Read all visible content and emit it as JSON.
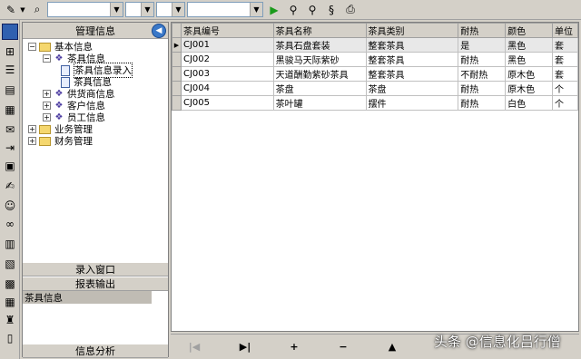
{
  "toolbar": {
    "icons": [
      "pencil-icon",
      "dropdown-arrow-icon",
      "search-icon",
      "play-icon",
      "binoculars-icon",
      "binoculars-next-icon",
      "replace-icon",
      "print-icon"
    ],
    "combos": [
      "",
      "",
      "",
      ""
    ]
  },
  "sidebar": {
    "icons": [
      "window-icon",
      "network-icon",
      "list-icon",
      "document-icon",
      "chart-icon",
      "envelope-icon",
      "export-icon",
      "grid-icon",
      "edit-icon",
      "users-icon",
      "glasses-icon",
      "table-icon",
      "report-icon",
      "calculator-icon",
      "blocks-icon",
      "chess-icon",
      "trash-icon"
    ]
  },
  "tree_panel": {
    "title": "管理信息",
    "nodes": [
      {
        "label": "基本信息",
        "level": 0,
        "expander": "−",
        "icon": "folder-icon"
      },
      {
        "label": "茶具信息",
        "level": 1,
        "expander": "−",
        "icon": "gear-icon"
      },
      {
        "label": "茶具信息录入",
        "level": 2,
        "expander": "",
        "icon": "form-icon"
      },
      {
        "label": "茶具信息",
        "level": 2,
        "expander": "",
        "icon": "form-icon"
      },
      {
        "label": "供货商信息",
        "level": 1,
        "expander": "+",
        "icon": "gear-icon"
      },
      {
        "label": "客户信息",
        "level": 1,
        "expander": "+",
        "icon": "gear-icon"
      },
      {
        "label": "员工信息",
        "level": 1,
        "expander": "+",
        "icon": "gear-icon"
      },
      {
        "label": "业务管理",
        "level": 0,
        "expander": "+",
        "icon": "folder-icon"
      },
      {
        "label": "财务管理",
        "level": 0,
        "expander": "+",
        "icon": "folder-icon"
      }
    ],
    "section_input": "录入窗口",
    "section_report": "报表输出",
    "selected_item": "茶具信息",
    "section_analysis": "信息分析"
  },
  "grid": {
    "columns": [
      "茶具编号",
      "茶具名称",
      "茶具类别",
      "耐热",
      "颜色",
      "单位"
    ],
    "rows": [
      [
        "CJ001",
        "茶具石盘套装",
        "整套茶具",
        "是",
        "黑色",
        "套"
      ],
      [
        "CJ002",
        "黑骏马天际紫砂",
        "整套茶具",
        "耐热",
        "黑色",
        "套"
      ],
      [
        "CJ003",
        "天道酬勤紫砂茶具",
        "整套茶具",
        "不耐热",
        "原木色",
        "套"
      ],
      [
        "CJ004",
        "茶盘",
        "茶盘",
        "耐热",
        "原木色",
        "个"
      ],
      [
        "CJ005",
        "茶叶罐",
        "摆件",
        "耐热",
        "白色",
        "个"
      ]
    ],
    "selected_row": 0
  },
  "navigator": {
    "buttons": [
      {
        "name": "first-record-button",
        "glyph": "|◀",
        "enabled": false
      },
      {
        "name": "last-record-button",
        "glyph": "▶|",
        "enabled": true
      },
      {
        "name": "add-record-button",
        "glyph": "+",
        "enabled": true
      },
      {
        "name": "delete-record-button",
        "glyph": "−",
        "enabled": true
      },
      {
        "name": "edit-record-button",
        "glyph": "▲",
        "enabled": true
      }
    ]
  },
  "watermark": "头条 @信息化吕行僧",
  "colors": {
    "selected_bg": "#c0bcb4",
    "window_bg": "#d4d0c8",
    "folder": "#f5d76e"
  }
}
